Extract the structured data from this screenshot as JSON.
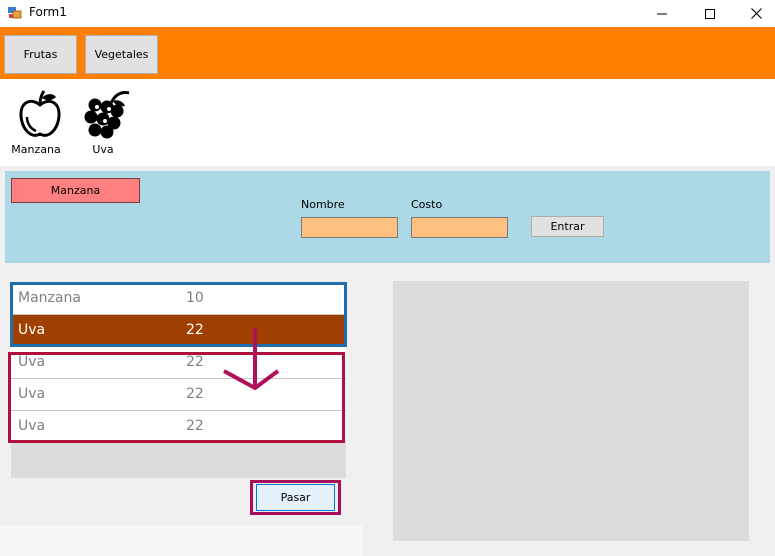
{
  "window": {
    "title": "Form1"
  },
  "menu": {
    "frutas": "Frutas",
    "vegetales": "Vegetales"
  },
  "items": [
    {
      "label": "Manzana",
      "icon": "apple-icon"
    },
    {
      "label": "Uva",
      "icon": "grapes-icon"
    }
  ],
  "form": {
    "selected": "Manzana",
    "nombre_label": "Nombre",
    "costo_label": "Costo",
    "nombre_value": "",
    "costo_value": "",
    "entrar": "Entrar"
  },
  "list": {
    "rows": [
      {
        "name": "Manzana",
        "value": "10",
        "selected": false
      },
      {
        "name": "Uva",
        "value": "22",
        "selected": true
      },
      {
        "name": "Uva",
        "value": "22",
        "selected": false
      },
      {
        "name": "Uva",
        "value": "22",
        "selected": false
      },
      {
        "name": "Uva",
        "value": "22",
        "selected": false
      }
    ]
  },
  "buttons": {
    "pasar": "Pasar"
  },
  "colors": {
    "menu_bar": "#ff8000",
    "input_panel": "#add8e6",
    "selected_row": "#a04000",
    "highlight_blue": "#1f6fb0",
    "highlight_red": "#b0103c"
  }
}
